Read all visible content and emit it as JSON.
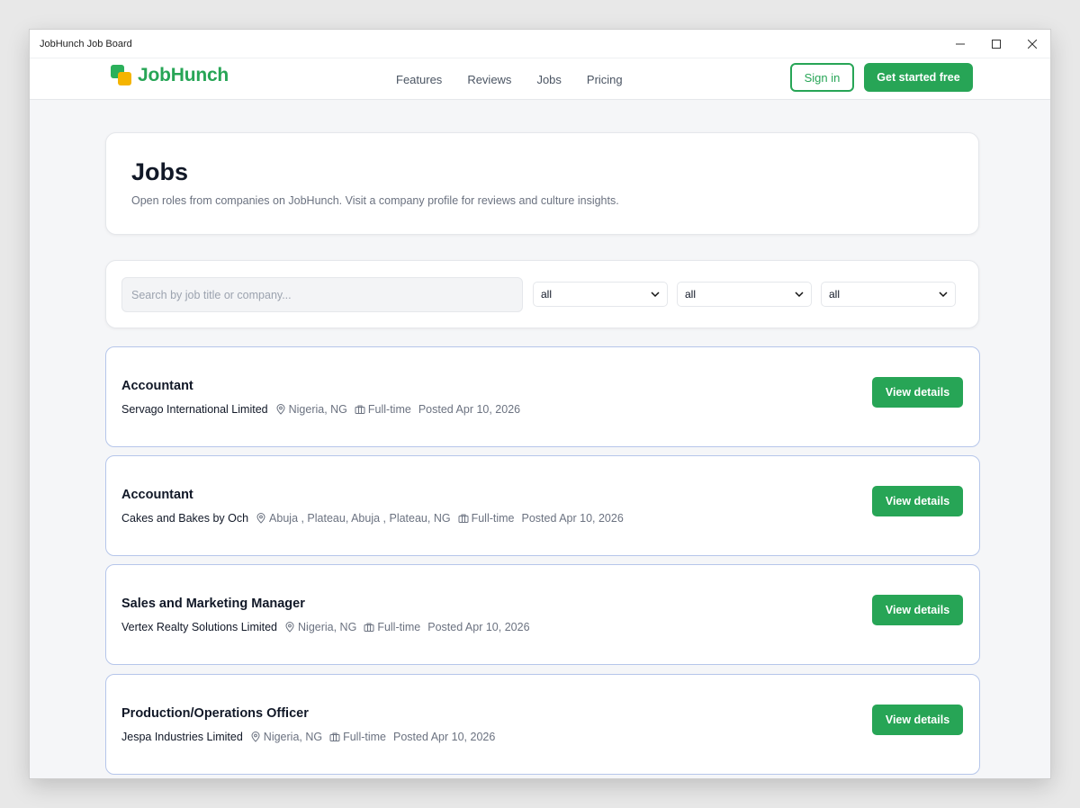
{
  "window": {
    "title": "JobHunch Job Board"
  },
  "nav": {
    "brand": "JobHunch",
    "links": [
      "Features",
      "Reviews",
      "Jobs",
      "Pricing"
    ],
    "signin_label": "Sign in",
    "cta_label": "Get started free"
  },
  "header": {
    "title": "Jobs",
    "subtitle": "Open roles from companies on JobHunch. Visit a company profile for reviews and culture insights."
  },
  "filters": {
    "search_placeholder": "Search by job title or company...",
    "selects": [
      "all",
      "all",
      "all"
    ]
  },
  "jobs": [
    {
      "title": "Accountant",
      "company": "Servago International Limited",
      "location": "Nigeria, NG",
      "type": "Full-time",
      "posted": "Posted Apr 10, 2026",
      "action": "View details"
    },
    {
      "title": "Accountant",
      "company": "Cakes and Bakes by Och",
      "location": "Abuja , Plateau, Abuja , Plateau, NG",
      "type": "Full-time",
      "posted": "Posted Apr 10, 2026",
      "action": "View details"
    },
    {
      "title": "Sales and Marketing Manager",
      "company": "Vertex Realty Solutions Limited",
      "location": "Nigeria, NG",
      "type": "Full-time",
      "posted": "Posted Apr 10, 2026",
      "action": "View details"
    },
    {
      "title": "Production/Operations Officer",
      "company": "Jespa Industries Limited",
      "location": "Nigeria, NG",
      "type": "Full-time",
      "posted": "Posted Apr 10, 2026",
      "action": "View details"
    }
  ],
  "icons": {
    "location": "map-pin-icon",
    "type": "briefcase-icon",
    "select": "chevron-down-icon",
    "window": [
      "minimize-icon",
      "maximize-icon",
      "close-icon"
    ]
  },
  "colors": {
    "brand_green": "#27a556",
    "brand_yellow": "#f5b400",
    "card_border": "#b6c6ea"
  }
}
